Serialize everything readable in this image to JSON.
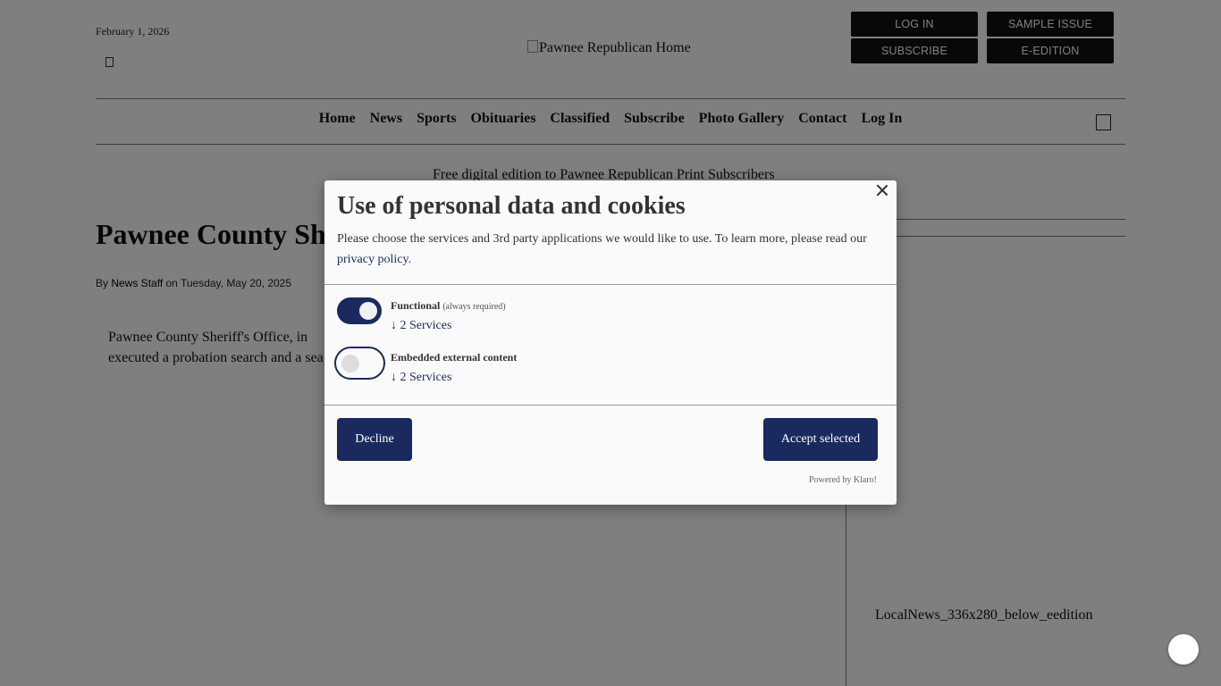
{
  "header": {
    "date": "February 1, 2026",
    "logo_alt": "Pawnee Republican Home",
    "buttons": {
      "login": "LOG IN",
      "sample": "SAMPLE ISSUE",
      "subscribe": "SUBSCRIBE",
      "eedition": "E-EDITION"
    }
  },
  "nav": {
    "items": [
      "Home",
      "News",
      "Sports",
      "Obituaries",
      "Classified",
      "Subscribe",
      "Photo Gallery",
      "Contact",
      "Log In"
    ]
  },
  "banner_alt": "Free digital edition to Pawnee Republican Print Subscribers",
  "article": {
    "title": "Pawnee County Sh",
    "byline_prefix": "By ",
    "author": "News Staff",
    "byline_suffix": " on Tuesday, May 20, 2025",
    "image_alt": "Pawnee County Sheriff's Office, in executed a probation search and a sea"
  },
  "sidebar": {
    "ad_alt": "LocalNews_336x280_below_eedition"
  },
  "modal": {
    "title": "Use of personal data and cookies",
    "desc_text": "Please choose the services and 3rd party applications we would like to use. To learn more, please read our ",
    "privacy_link": "privacy policy",
    "desc_end": ".",
    "services": [
      {
        "title": "Functional",
        "note": "(always required)",
        "link": "↓ 2 Services",
        "enabled": true
      },
      {
        "title": "Embedded external content",
        "note": "",
        "link": "↓ 2 Services",
        "enabled": false
      }
    ],
    "decline": "Decline",
    "accept": "Accept selected",
    "powered": "Powered by Klaro!"
  },
  "colors": {
    "accent": "#1a2a5e",
    "overlay": "rgba(0,0,0,0.5)"
  }
}
